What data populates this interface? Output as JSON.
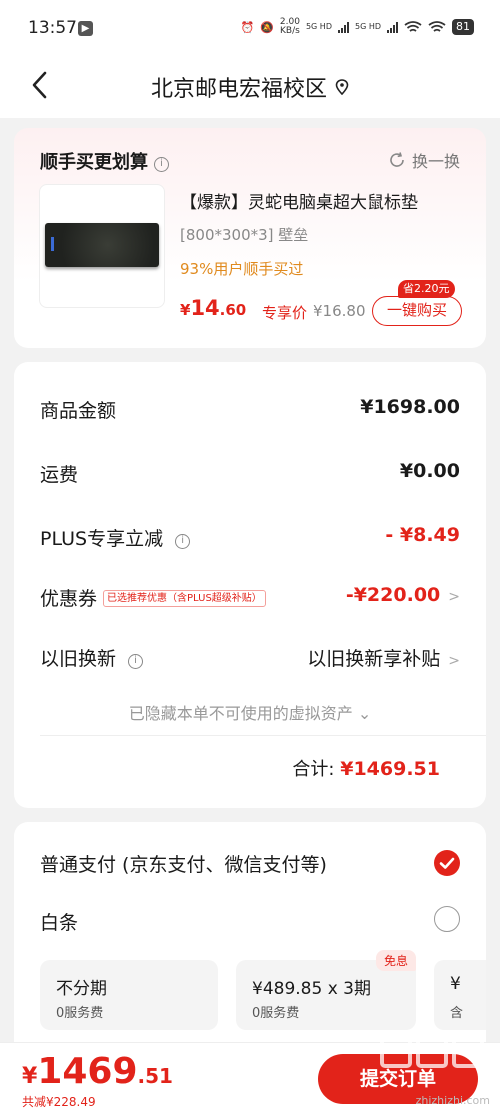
{
  "status_bar": {
    "time": "13:57",
    "speed_value": "2.00",
    "speed_unit": "KB/s",
    "signal1_label": "5G HD",
    "signal2_label": "5G HD",
    "battery": "81"
  },
  "nav": {
    "title": "北京邮电宏福校区"
  },
  "bundle": {
    "title": "顺手买更划算",
    "swap_label": "换一换",
    "product_name": "【爆款】灵蛇电脑桌超大鼠标垫",
    "product_spec": "[800*300*3] 壁垒",
    "social_proof": "93%用户顺手买过",
    "price_symbol": "¥",
    "price_int": "14",
    "price_dec": ".60",
    "exclusive_label": "专享价",
    "original_price": "¥16.80",
    "save_badge": "省2.20元",
    "buy_button": "一键购买"
  },
  "summary": {
    "goods_label": "商品金额",
    "goods_value": "¥1698.00",
    "shipping_label": "运费",
    "shipping_value": "¥0.00",
    "plus_label": "PLUS专享立减",
    "plus_value": "- ¥8.49",
    "coupon_label": "优惠券",
    "coupon_tag": "已选推荐优惠（含PLUS超级补贴）",
    "coupon_value": "-¥220.00",
    "tradein_label": "以旧换新",
    "tradein_value": "以旧换新享补贴",
    "hidden_assets": "已隐藏本单不可使用的虚拟资产",
    "total_label": "合计:",
    "total_value": "¥1469.51"
  },
  "payment": {
    "option1": "普通支付 (京东支付、微信支付等)",
    "option2": "白条",
    "plans": [
      {
        "title": "不分期",
        "sub": "0服务费"
      },
      {
        "title": "¥489.85 x 3期",
        "sub": "0服务费",
        "badge": "免息"
      },
      {
        "title": "¥",
        "sub": "含"
      }
    ]
  },
  "bottom": {
    "price_symbol": "¥",
    "price_int": "1469",
    "price_dec": ".51",
    "saved": "共减¥228.49",
    "submit": "提交订单"
  },
  "watermark": {
    "text": "zhizhizhi.com"
  },
  "colors": {
    "accent": "#e2231a",
    "social_orange": "#e08a1e"
  }
}
